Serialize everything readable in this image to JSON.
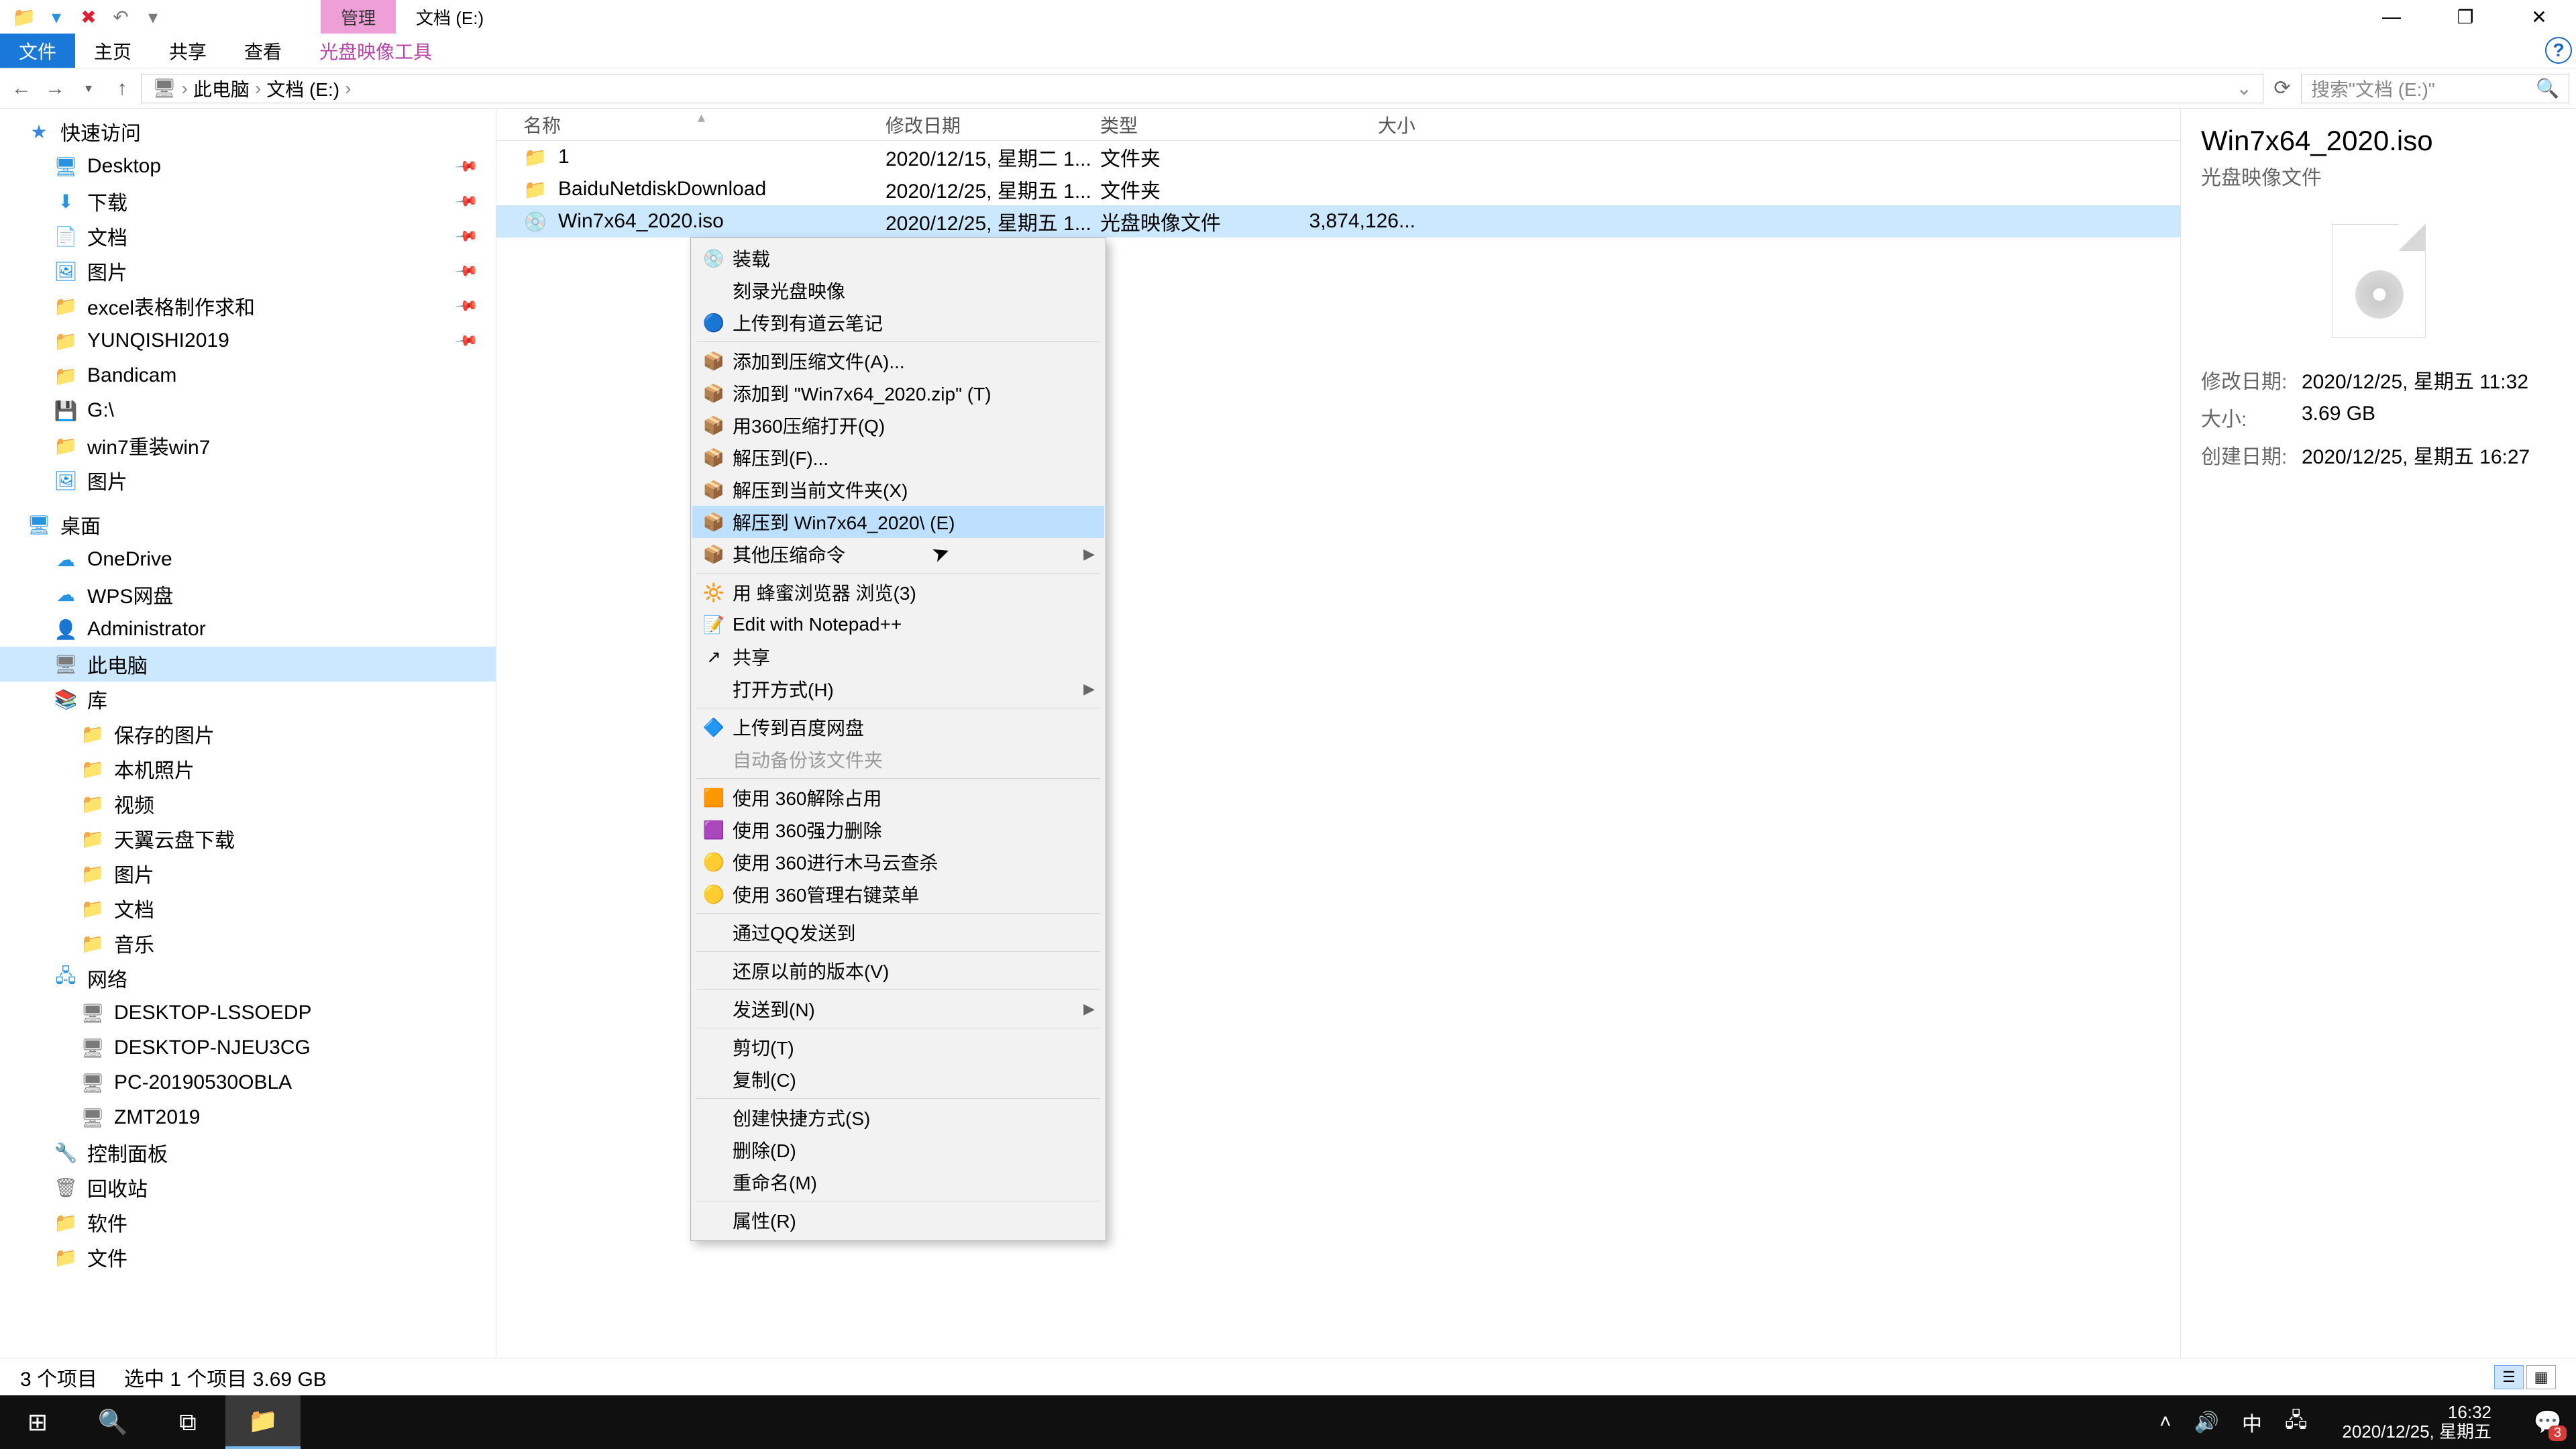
{
  "title_tabs": {
    "manage": "管理",
    "drive": "文档 (E:)"
  },
  "ribbon": {
    "file": "文件",
    "home": "主页",
    "share": "共享",
    "view": "查看",
    "disc": "光盘映像工具"
  },
  "breadcrumb": {
    "root": "此电脑",
    "drive": "文档 (E:)"
  },
  "search_placeholder": "搜索\"文档 (E:)\"",
  "columns": {
    "name": "名称",
    "date": "修改日期",
    "type": "类型",
    "size": "大小"
  },
  "nav": {
    "quick": "快速访问",
    "quick_items": [
      "Desktop",
      "下载",
      "文档",
      "图片",
      "excel表格制作求和",
      "YUNQISHI2019",
      "Bandicam",
      "G:\\",
      "win7重装win7",
      "图片"
    ],
    "desktop": "桌面",
    "desktop_items": [
      "OneDrive",
      "WPS网盘",
      "Administrator",
      "此电脑",
      "库"
    ],
    "lib_items": [
      "保存的图片",
      "本机照片",
      "视频",
      "天翼云盘下载",
      "图片",
      "文档",
      "音乐"
    ],
    "network": "网络",
    "net_items": [
      "DESKTOP-LSSOEDP",
      "DESKTOP-NJEU3CG",
      "PC-20190530OBLA",
      "ZMT2019"
    ],
    "tail": [
      "控制面板",
      "回收站",
      "软件",
      "文件"
    ]
  },
  "rows": [
    {
      "name": "1",
      "date": "2020/12/15, 星期二 1...",
      "type": "文件夹",
      "size": ""
    },
    {
      "name": "BaiduNetdiskDownload",
      "date": "2020/12/25, 星期五 1...",
      "type": "文件夹",
      "size": ""
    },
    {
      "name": "Win7x64_2020.iso",
      "date": "2020/12/25, 星期五 1...",
      "type": "光盘映像文件",
      "size": "3,874,126..."
    }
  ],
  "ctx": [
    {
      "t": "装载",
      "i": "💿"
    },
    {
      "t": "刻录光盘映像"
    },
    {
      "t": "上传到有道云笔记",
      "i": "🔵"
    },
    {
      "sep": true
    },
    {
      "t": "添加到压缩文件(A)...",
      "i": "📦"
    },
    {
      "t": "添加到 \"Win7x64_2020.zip\" (T)",
      "i": "📦"
    },
    {
      "t": "用360压缩打开(Q)",
      "i": "📦"
    },
    {
      "t": "解压到(F)...",
      "i": "📦"
    },
    {
      "t": "解压到当前文件夹(X)",
      "i": "📦"
    },
    {
      "t": "解压到 Win7x64_2020\\ (E)",
      "i": "📦",
      "hov": true
    },
    {
      "t": "其他压缩命令",
      "i": "📦",
      "sub": true
    },
    {
      "sep": true
    },
    {
      "t": "用 蜂蜜浏览器 浏览(3)",
      "i": "🔆"
    },
    {
      "t": "Edit with Notepad++",
      "i": "📝"
    },
    {
      "t": "共享",
      "i": "↗"
    },
    {
      "t": "打开方式(H)",
      "sub": true
    },
    {
      "sep": true
    },
    {
      "t": "上传到百度网盘",
      "i": "🔷"
    },
    {
      "t": "自动备份该文件夹",
      "dis": true
    },
    {
      "sep": true
    },
    {
      "t": "使用 360解除占用",
      "i": "🟧"
    },
    {
      "t": "使用 360强力删除",
      "i": "🟪"
    },
    {
      "t": "使用 360进行木马云查杀",
      "i": "🟡"
    },
    {
      "t": "使用 360管理右键菜单",
      "i": "🟡"
    },
    {
      "sep": true
    },
    {
      "t": "通过QQ发送到"
    },
    {
      "sep": true
    },
    {
      "t": "还原以前的版本(V)"
    },
    {
      "sep": true
    },
    {
      "t": "发送到(N)",
      "sub": true
    },
    {
      "sep": true
    },
    {
      "t": "剪切(T)"
    },
    {
      "t": "复制(C)"
    },
    {
      "sep": true
    },
    {
      "t": "创建快捷方式(S)"
    },
    {
      "t": "删除(D)"
    },
    {
      "t": "重命名(M)"
    },
    {
      "sep": true
    },
    {
      "t": "属性(R)"
    }
  ],
  "details": {
    "title": "Win7x64_2020.iso",
    "sub": "光盘映像文件",
    "meta": {
      "mdate_l": "修改日期:",
      "mdate": "2020/12/25, 星期五 11:32",
      "size_l": "大小:",
      "size": "3.69 GB",
      "cdate_l": "创建日期:",
      "cdate": "2020/12/25, 星期五 16:27"
    }
  },
  "status": {
    "count": "3 个项目",
    "sel": "选中 1 个项目  3.69 GB"
  },
  "tray": {
    "ime": "中",
    "time": "16:32",
    "date": "2020/12/25, 星期五",
    "badge": "3"
  }
}
